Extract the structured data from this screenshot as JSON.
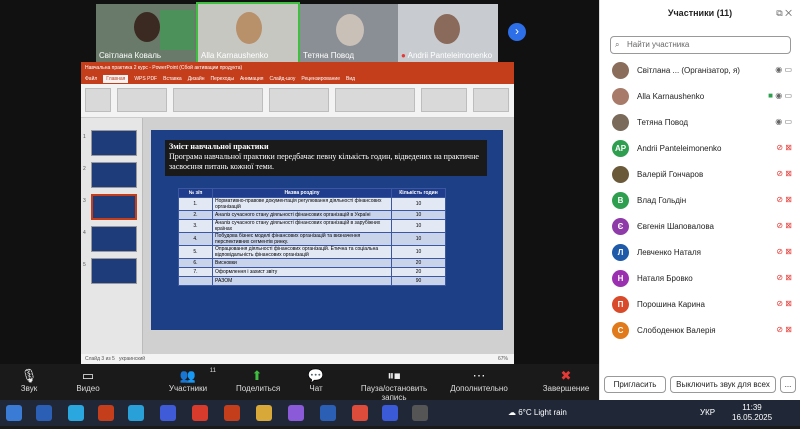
{
  "videos": [
    {
      "name": "Світлана Коваль"
    },
    {
      "name": "Alla Karnaushenko"
    },
    {
      "name": "Тетяна Повод"
    },
    {
      "name": "Andrii Panteleimonenko"
    }
  ],
  "ppt": {
    "title": "Навчальна практика 2 курс - PowerPoint (Сбой активации продукта)",
    "tabs": [
      "Файл",
      "Главная",
      "WPS PDF",
      "Вставка",
      "Дизайн",
      "Переходы",
      "Анимация",
      "Слайд-шоу",
      "Рецензирование",
      "Вид"
    ],
    "status_left": "Слайд 3 из 5",
    "status_lang": "украинский",
    "zoom": "67%",
    "slide_heading": "Зміст навчальної практики",
    "slide_text": "Програма навчальної практики передбачає певну кількість годин, відведених на практичне засвоєння питань кожної теми.",
    "table": {
      "headers": [
        "№ з/п",
        "Назва розділу",
        "Кількість годин"
      ],
      "rows": [
        {
          "n": "1.",
          "name": "Нормативно-правове документація регулювання діяльності фінансових організацій",
          "hours": "10"
        },
        {
          "n": "2.",
          "name": "Аналіз сучасного стану діяльності фінансових організацій в Україні",
          "hours": "10"
        },
        {
          "n": "3.",
          "name": "Аналіз сучасного стану діяльності фінансових організацій в зарубіжних країнах",
          "hours": "10"
        },
        {
          "n": "4.",
          "name": "Побудова бізнес моделі фінансових організацій та визначення перспективних сегментів ринку.",
          "hours": "10"
        },
        {
          "n": "5.",
          "name": "Опрацювання діяльності фінансових організацій. Етична та соціальна відповідальність фінансових організацій",
          "hours": "10"
        },
        {
          "n": "6.",
          "name": "Висновки",
          "hours": "20"
        },
        {
          "n": "7.",
          "name": "Оформлення і захист звіту",
          "hours": "20"
        },
        {
          "n": "",
          "name": "РАЗОМ",
          "hours": "90"
        }
      ]
    }
  },
  "sidebar": {
    "title": "Участники (11)",
    "search_placeholder": "Найти участника",
    "participants": [
      {
        "name": "Світлана ... (Організатор, я)",
        "color": "#8a6d5a",
        "initial": ""
      },
      {
        "name": "Alla Karnaushenko",
        "color": "#a87a6a",
        "initial": ""
      },
      {
        "name": "Тетяна Повод",
        "color": "#7a6a5a",
        "initial": ""
      },
      {
        "name": "Andrii Panteleimonenko",
        "color": "#2e9e4f",
        "initial": "AP"
      },
      {
        "name": "Валерій Гончаров",
        "color": "#6b5a3a",
        "initial": ""
      },
      {
        "name": "Влад Гольдін",
        "color": "#2e9e4f",
        "initial": "В"
      },
      {
        "name": "Євгенія Шаповалова",
        "color": "#8e3aa8",
        "initial": "Є"
      },
      {
        "name": "Левченко Наталя",
        "color": "#1f5aa8",
        "initial": "Л"
      },
      {
        "name": "Наталя Бровко",
        "color": "#9a2fb0",
        "initial": "Н"
      },
      {
        "name": "Порошина Карина",
        "color": "#d84a2a",
        "initial": "П"
      },
      {
        "name": "Слободенюк Валерія",
        "color": "#e07a1a",
        "initial": "С"
      }
    ],
    "invite_label": "Пригласить",
    "mute_all_label": "Выключить звук для всех",
    "more_label": "..."
  },
  "controls": {
    "audio": "Звук",
    "video": "Видео",
    "participants": "Участники",
    "participants_count": "11",
    "share": "Поделиться",
    "chat": "Чат",
    "pause_record": "Пауза/остановить запись",
    "more": "Дополнительно",
    "end": "Завершение"
  },
  "taskbar": {
    "weather": "6°C  Light rain",
    "lang": "УКР",
    "time": "11:39",
    "date": "16.05.2025"
  }
}
